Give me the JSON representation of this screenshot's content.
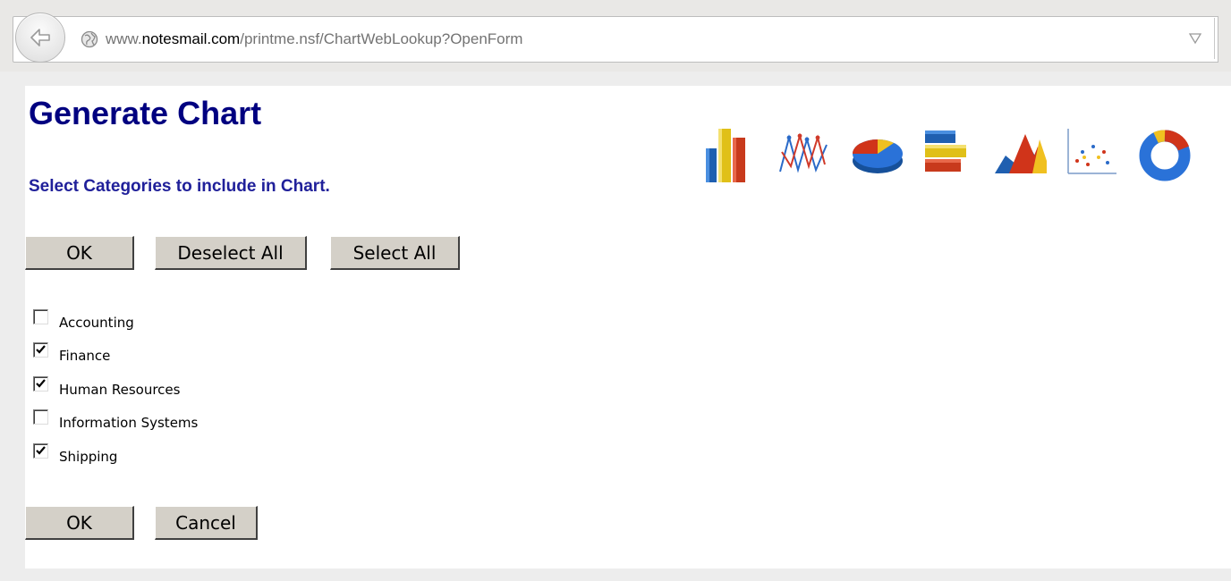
{
  "browser": {
    "url_prefix": "www.",
    "url_host": "notesmail.com",
    "url_path": "/printme.nsf/ChartWebLookup?OpenForm"
  },
  "page": {
    "title": "Generate Chart",
    "subtitle": "Select Categories to include in Chart."
  },
  "top_buttons": {
    "ok": "OK",
    "deselect_all": "Deselect All",
    "select_all": "Select All"
  },
  "categories": [
    {
      "label": "Accounting",
      "checked": false
    },
    {
      "label": "Finance",
      "checked": true
    },
    {
      "label": "Human Resources",
      "checked": true
    },
    {
      "label": "Information Systems",
      "checked": false
    },
    {
      "label": "Shipping",
      "checked": true
    }
  ],
  "bottom_buttons": {
    "ok": "OK",
    "cancel": "Cancel"
  },
  "chart_type_icons": [
    "bar-chart-icon",
    "line-chart-icon",
    "pie-chart-icon",
    "horizontal-bar-chart-icon",
    "area-chart-icon",
    "scatter-chart-icon",
    "donut-chart-icon"
  ],
  "colors": {
    "title": "#000080",
    "subtitle": "#20209a",
    "button_face": "#d4d0c8"
  }
}
